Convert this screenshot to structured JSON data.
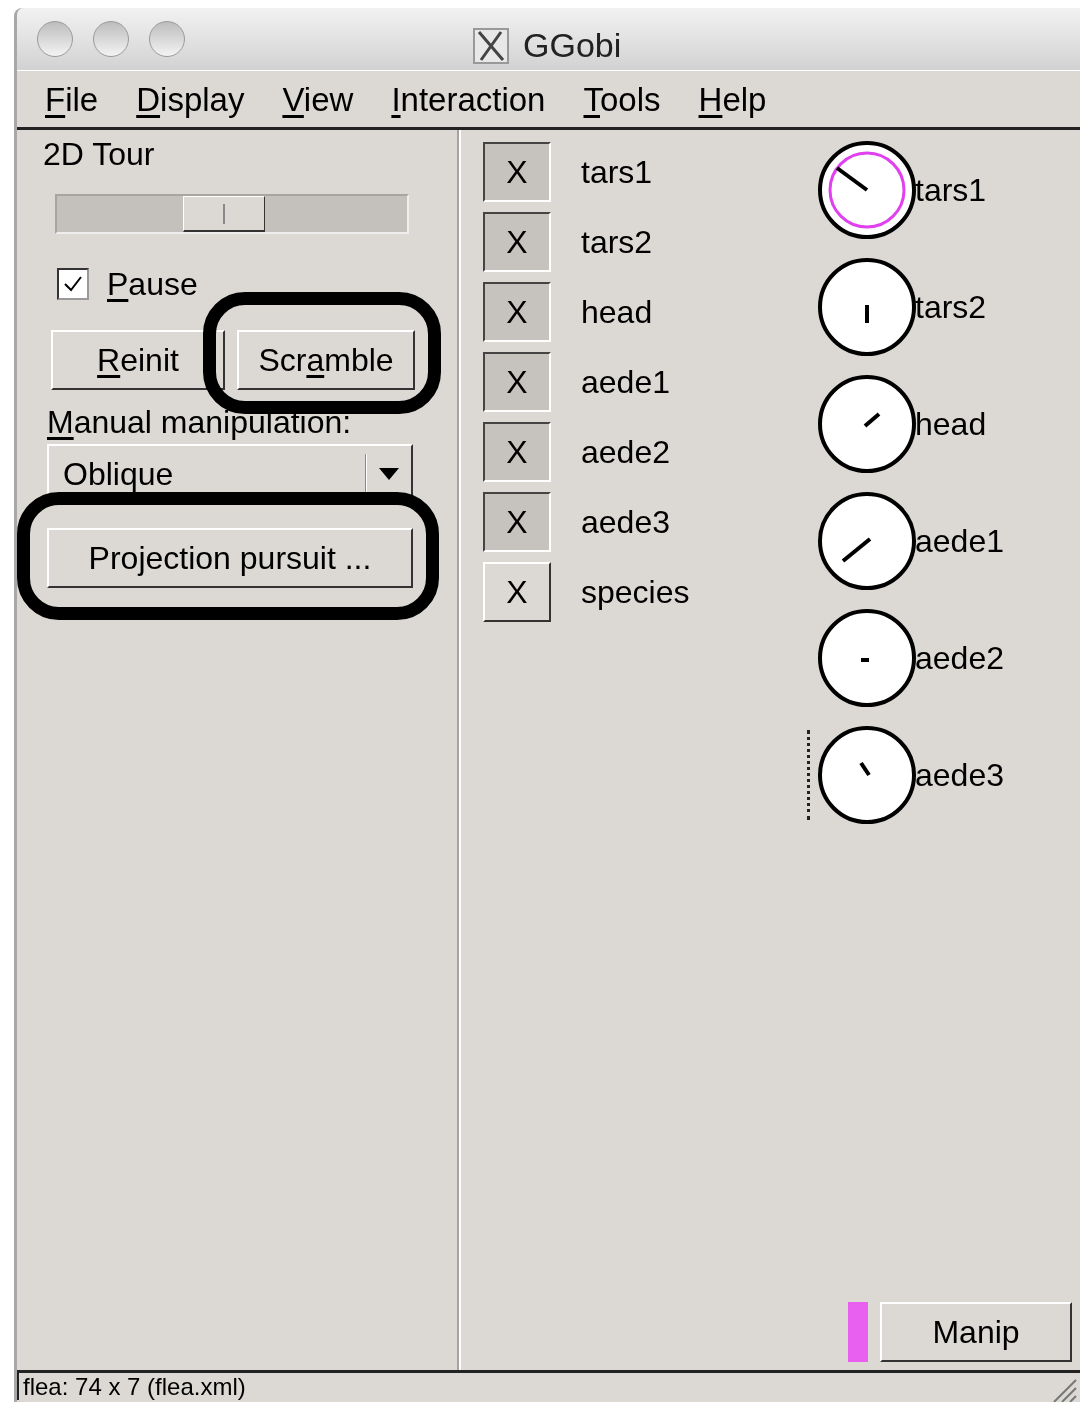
{
  "window": {
    "title": "GGobi"
  },
  "menu": [
    {
      "key": "F",
      "post": "ile"
    },
    {
      "key": "D",
      "post": "isplay"
    },
    {
      "key": "V",
      "post": "iew"
    },
    {
      "key": "I",
      "post": "nteraction"
    },
    {
      "key": "T",
      "post": "ools"
    },
    {
      "key": "H",
      "post": "elp"
    }
  ],
  "panel": {
    "title": "2D Tour",
    "pause": {
      "key": "P",
      "post": "ause",
      "checked": true
    },
    "buttons": [
      {
        "key": "R",
        "post": "einit",
        "highlighted": false
      },
      {
        "pre": "Scr",
        "key": "a",
        "post": "mble",
        "highlighted": true
      }
    ],
    "manual_label": {
      "key": "M",
      "post": "anual manipulation:"
    },
    "manual_select": {
      "value": "Oblique"
    },
    "pursuit_button": {
      "label": "Projection pursuit ...",
      "highlighted": true
    }
  },
  "variables": [
    {
      "toggle": "X",
      "label": "tars1",
      "checked": true
    },
    {
      "toggle": "X",
      "label": "tars2",
      "checked": true
    },
    {
      "toggle": "X",
      "label": "head",
      "checked": true
    },
    {
      "toggle": "X",
      "label": "aede1",
      "checked": true
    },
    {
      "toggle": "X",
      "label": "aede2",
      "checked": true
    },
    {
      "toggle": "X",
      "label": "aede3",
      "checked": true
    },
    {
      "toggle": "X",
      "label": "species",
      "checked": false
    }
  ],
  "dials": [
    {
      "label": "tars1",
      "selected": true,
      "focused": false
    },
    {
      "label": "tars2",
      "selected": false,
      "focused": false
    },
    {
      "label": "head",
      "selected": false,
      "focused": false
    },
    {
      "label": "aede1",
      "selected": false,
      "focused": false
    },
    {
      "label": "aede2",
      "selected": false,
      "focused": false
    },
    {
      "label": "aede3",
      "selected": false,
      "focused": true
    }
  ],
  "manip_button": {
    "label": "Manip"
  },
  "status_bar": "flea: 74 x 7 (flea.xml)"
}
